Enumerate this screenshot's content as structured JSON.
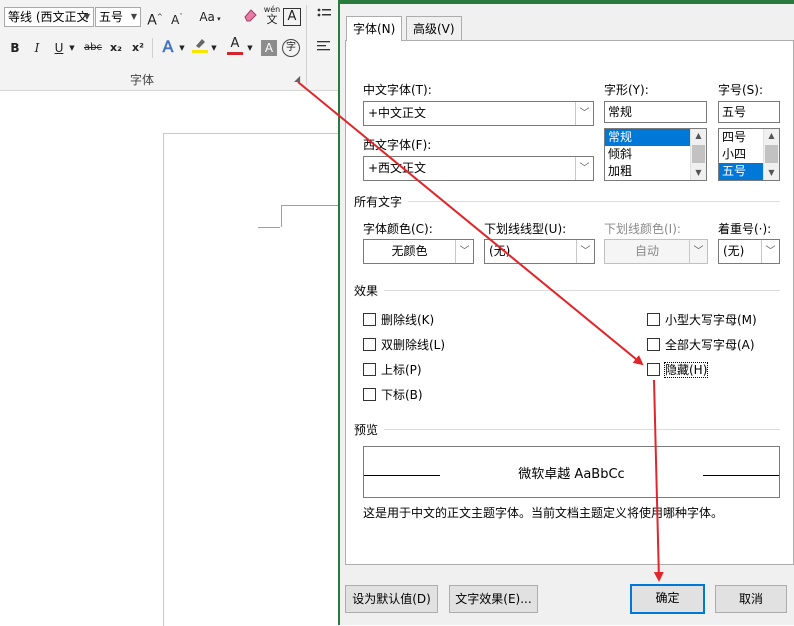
{
  "ribbon": {
    "font_name": "等线 (西文正文",
    "font_size": "五号",
    "grow_font": "A",
    "shrink_font": "A",
    "change_case": "Aa",
    "phonetic_top": "wén",
    "phonetic_bottom": "文",
    "char_border": "A",
    "bold": "B",
    "italic": "I",
    "underline": "U",
    "strikethrough": "abc",
    "subscript": "x₂",
    "superscript": "x²",
    "text_effects": "A",
    "font_color": "A",
    "char_shading": "A",
    "enclose": "字",
    "group_label": "字体",
    "highlight_color": "#f7e600",
    "font_color_value": "#d1262e"
  },
  "dialog": {
    "tabs": [
      {
        "label": "字体(N)"
      },
      {
        "label": "高级(V)"
      }
    ],
    "cn_font_label": "中文字体(T):",
    "cn_font_value": "+中文正文",
    "west_font_label": "西文字体(F):",
    "west_font_value": "+西文正文",
    "style_label": "字形(Y):",
    "style_value": "常规",
    "style_items": [
      "常规",
      "倾斜",
      "加粗"
    ],
    "size_label": "字号(S):",
    "size_value": "五号",
    "size_items": [
      "四号",
      "小四",
      "五号"
    ],
    "all_text_section": "所有文字",
    "font_color_label": "字体颜色(C):",
    "font_color_value": "无颜色",
    "underline_label": "下划线线型(U):",
    "underline_value": "(无)",
    "underline_color_label": "下划线颜色(I):",
    "underline_color_value": "自动",
    "emphasis_label": "着重号(·):",
    "emphasis_value": "(无)",
    "effects_section": "效果",
    "effects_left": [
      "删除线(K)",
      "双删除线(L)",
      "上标(P)",
      "下标(B)"
    ],
    "effects_right": [
      "小型大写字母(M)",
      "全部大写字母(A)",
      "隐藏(H)"
    ],
    "preview_section": "预览",
    "preview_text": "微软卓越  AaBbCc",
    "preview_note": "这是用于中文的正文主题字体。当前文档主题定义将使用哪种字体。",
    "btn_default": "设为默认值(D)",
    "btn_effects": "文字效果(E)...",
    "btn_ok": "确定",
    "btn_cancel": "取消"
  },
  "colors": {
    "accent": "#0078d7",
    "annotation_arrow": "#e0262b",
    "dialog_border": "#2b7a3d"
  }
}
